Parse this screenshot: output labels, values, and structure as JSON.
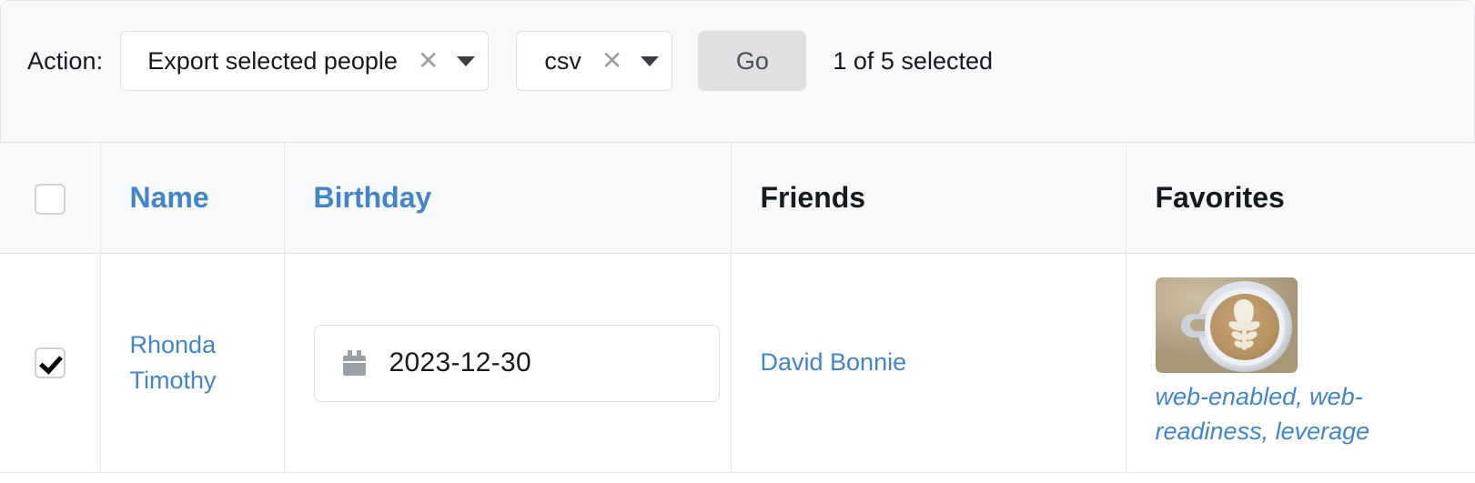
{
  "action_bar": {
    "label": "Action:",
    "action_select": {
      "value": "Export selected people",
      "clear_icon": "close-x-icon",
      "caret_icon": "chevron-down-icon"
    },
    "format_select": {
      "value": "csv",
      "clear_icon": "close-x-icon",
      "caret_icon": "chevron-down-icon"
    },
    "go_label": "Go",
    "selected_count": "1 of 5 selected"
  },
  "table": {
    "headers": [
      {
        "label": "",
        "type": "checkbox",
        "name": "select-all-checkbox",
        "checked": false
      },
      {
        "label": "Name",
        "type": "link"
      },
      {
        "label": "Birthday",
        "type": "link"
      },
      {
        "label": "Friends",
        "type": "plain"
      },
      {
        "label": "Favorites",
        "type": "plain"
      }
    ],
    "rows": [
      {
        "selected": true,
        "name": "Rhonda Timothy",
        "birthday": "2023-12-30",
        "friends": "David Bonnie",
        "favorites_tags": "web-enabled, web-readiness, leverage",
        "favorites_image_alt": "latte-art-coffee-cup-thumbnail"
      }
    ]
  },
  "colors": {
    "link": "#4285c8",
    "header_bg": "#f8f9fa",
    "go_button_bg": "#dfe0e2",
    "border": "#e6e8eb",
    "text": "#16191d"
  }
}
